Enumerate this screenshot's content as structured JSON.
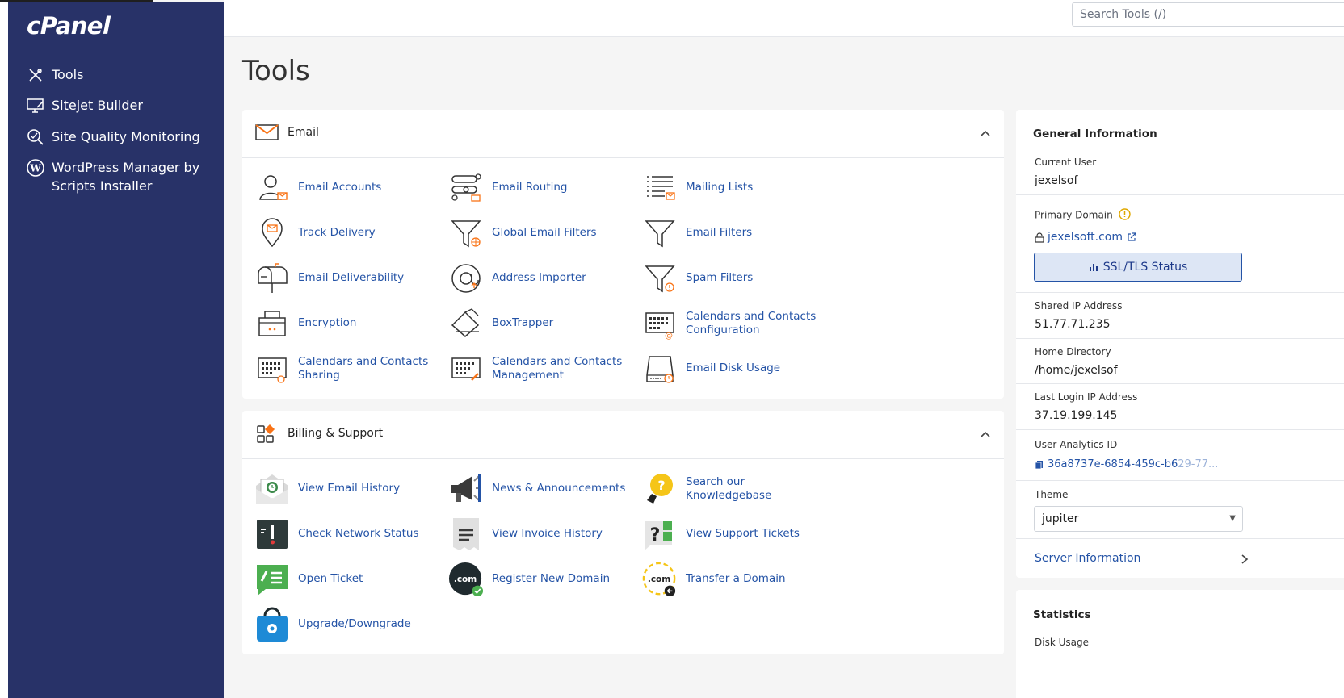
{
  "app": {
    "logo": "cPanel"
  },
  "search": {
    "placeholder": "Search Tools (/)"
  },
  "sidebar": {
    "items": [
      {
        "label": "Tools"
      },
      {
        "label": "Sitejet Builder"
      },
      {
        "label": "Site Quality Monitoring"
      },
      {
        "label": "WordPress Manager by Scripts Installer"
      }
    ]
  },
  "page": {
    "title": "Tools"
  },
  "email_section": {
    "title": "Email",
    "tools": [
      {
        "label": "Email Accounts",
        "icon": "user-mail-icon"
      },
      {
        "label": "Email Routing",
        "icon": "routing-icon"
      },
      {
        "label": "Mailing Lists",
        "icon": "list-mail-icon"
      },
      {
        "label": "Track Delivery",
        "icon": "map-pin-mail-icon"
      },
      {
        "label": "Global Email Filters",
        "icon": "funnel-globe-icon"
      },
      {
        "label": "Email Filters",
        "icon": "funnel-icon"
      },
      {
        "label": "Email Deliverability",
        "icon": "mailbox-icon"
      },
      {
        "label": "Address Importer",
        "icon": "at-sign-icon"
      },
      {
        "label": "Spam Filters",
        "icon": "funnel-warning-icon"
      },
      {
        "label": "Encryption",
        "icon": "encryption-icon"
      },
      {
        "label": "BoxTrapper",
        "icon": "box-trapper-icon"
      },
      {
        "label": "Calendars and Contacts Configuration",
        "icon": "calendar-at-icon"
      },
      {
        "label": "Calendars and Contacts Sharing",
        "icon": "calendar-share-icon"
      },
      {
        "label": "Calendars and Contacts Management",
        "icon": "calendar-edit-icon"
      },
      {
        "label": "Email Disk Usage",
        "icon": "disk-usage-icon"
      }
    ]
  },
  "billing_section": {
    "title": "Billing & Support",
    "tools": [
      {
        "label": "View Email History",
        "icon": "email-history-icon"
      },
      {
        "label": "News & Announcements",
        "icon": "megaphone-icon"
      },
      {
        "label": "Search our Knowledgebase",
        "icon": "lightbulb-icon"
      },
      {
        "label": "Check Network Status",
        "icon": "network-status-icon"
      },
      {
        "label": "View Invoice History",
        "icon": "invoice-icon"
      },
      {
        "label": "View Support Tickets",
        "icon": "support-tickets-icon"
      },
      {
        "label": "Open Ticket",
        "icon": "open-ticket-icon"
      },
      {
        "label": "Register New Domain",
        "icon": "register-domain-icon"
      },
      {
        "label": "Transfer a Domain",
        "icon": "transfer-domain-icon"
      },
      {
        "label": "Upgrade/Downgrade",
        "icon": "upgrade-bag-icon"
      }
    ]
  },
  "general_info": {
    "title": "General Information",
    "current_user_label": "Current User",
    "current_user": "jexelsof",
    "primary_domain_label": "Primary Domain",
    "primary_domain": "jexelsoft.com",
    "ssl_button": "SSL/TLS Status",
    "shared_ip_label": "Shared IP Address",
    "shared_ip": "51.77.71.235",
    "home_dir_label": "Home Directory",
    "home_dir": "/home/jexelsof",
    "last_login_label": "Last Login IP Address",
    "last_login": "37.19.199.145",
    "analytics_label": "User Analytics ID",
    "analytics_id": "36a8737e-6854-459c-b6",
    "analytics_id_faded": "29-77...",
    "theme_label": "Theme",
    "theme_value": "jupiter",
    "server_info": "Server Information"
  },
  "statistics": {
    "title": "Statistics",
    "disk_usage_label": "Disk Usage"
  },
  "colors": {
    "sidebar": "#283268",
    "link": "#2453a6",
    "accent_orange": "#f97316"
  }
}
